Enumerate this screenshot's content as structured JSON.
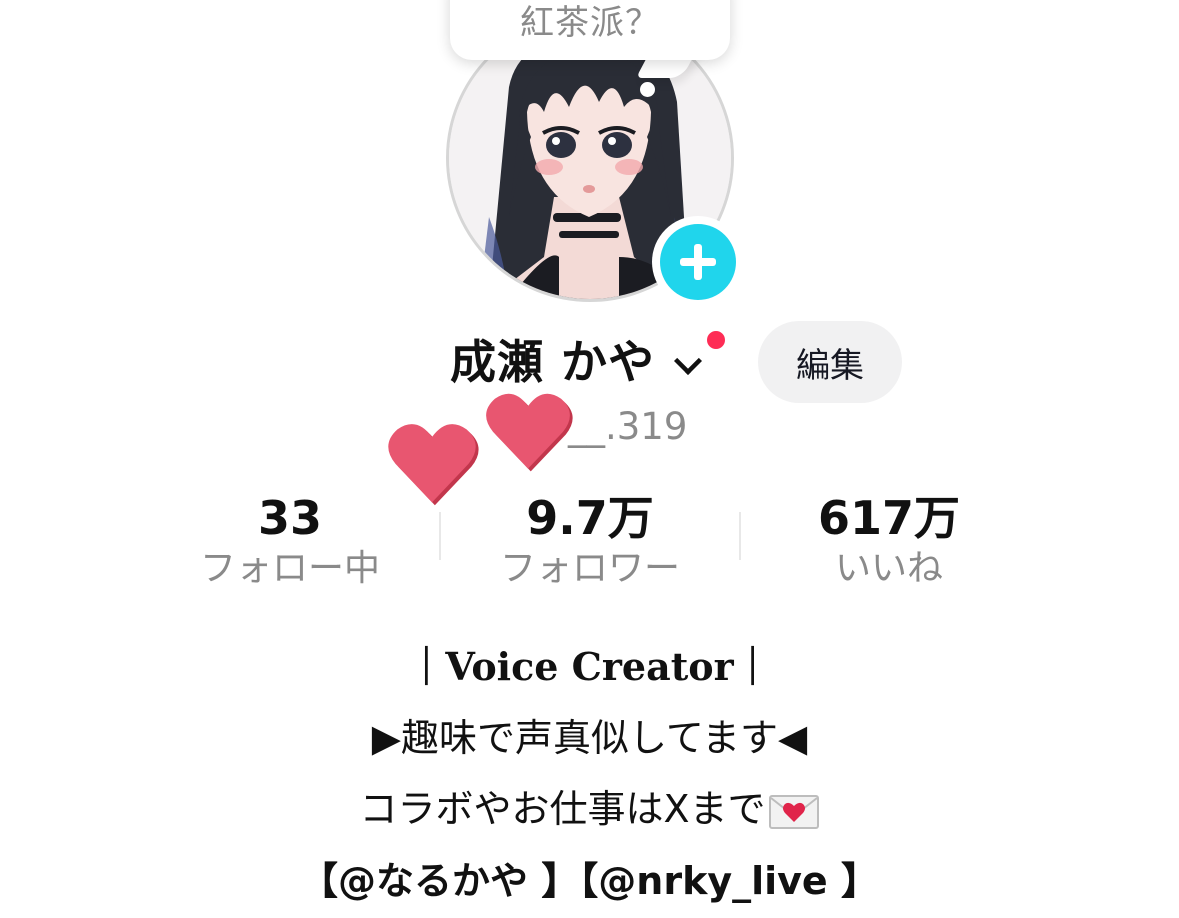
{
  "status_bubble": {
    "text": "紅茶派？"
  },
  "profile": {
    "display_name": "成瀬 かや",
    "username_visible": "__.319",
    "edit_button": "編集"
  },
  "stats": [
    {
      "value": "33",
      "label": "フォロー中"
    },
    {
      "value": "9.7万",
      "label": "フォロワー"
    },
    {
      "value": "617万",
      "label": "いいね"
    }
  ],
  "bio": {
    "line1": "｜Voice Creator｜",
    "line2": "▶趣味で声真似してます◀",
    "line3": "コラボやお仕事はXまで",
    "line4": "【@なるかや 】【@nrky_live 】"
  },
  "icons": {
    "add": "plus-icon",
    "chevron": "chevron-down-icon",
    "sticker": "heart-icon",
    "envelope": "love-letter-icon"
  },
  "colors": {
    "accent_cyan": "#20d5ec",
    "notification_red": "#fe2c55",
    "heart_pink": "#e85670",
    "muted_text": "#8a8a8a"
  }
}
